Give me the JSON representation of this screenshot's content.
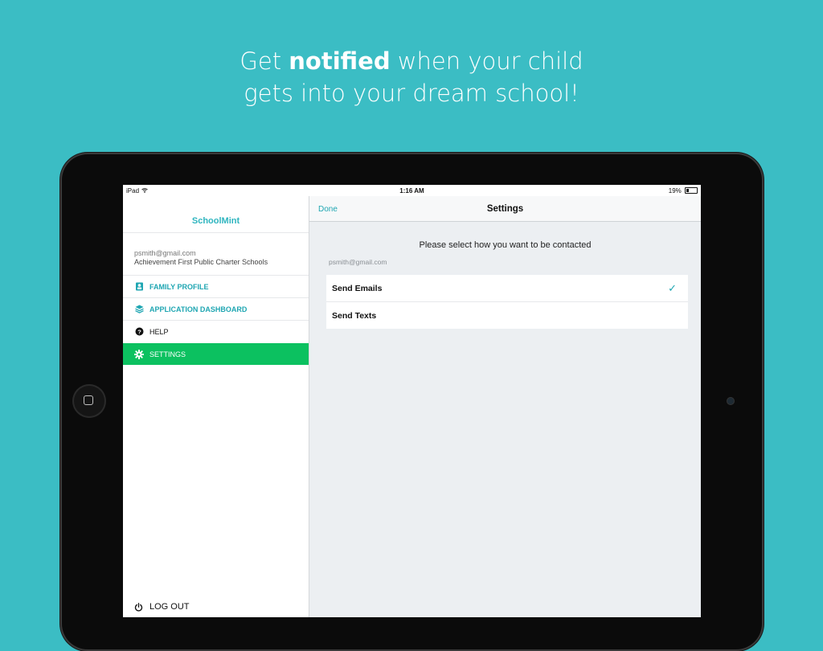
{
  "headline": {
    "part1": "Get ",
    "bold": "notified",
    "part2": " when your child",
    "line2": "gets into your dream school!"
  },
  "status_bar": {
    "device": "iPad",
    "time": "1:16 AM",
    "battery": "19%"
  },
  "sidebar": {
    "brand": "SchoolMint",
    "account_email": "psmith@gmail.com",
    "organization": "Achievement First Public Charter Schools",
    "items": [
      {
        "label": "FAMILY PROFILE",
        "icon": "profile-icon"
      },
      {
        "label": "APPLICATION DASHBOARD",
        "icon": "layers-icon"
      },
      {
        "label": "HELP",
        "icon": "help-icon"
      },
      {
        "label": "SETTINGS",
        "icon": "gear-icon",
        "active": true
      }
    ],
    "logout_label": "LOG OUT"
  },
  "navbar": {
    "done_label": "Done",
    "title": "Settings"
  },
  "settings": {
    "prompt": "Please select how you want to be contacted",
    "email": "psmith@gmail.com",
    "options": [
      {
        "label": "Send Emails",
        "checked": true
      },
      {
        "label": "Send Texts",
        "checked": false
      }
    ]
  },
  "colors": {
    "background": "#3bbdc4",
    "accent": "#1fa6b2",
    "active_item": "#0cc160"
  }
}
